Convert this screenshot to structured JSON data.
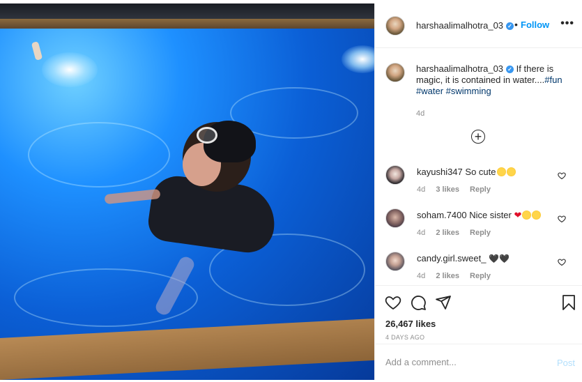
{
  "post": {
    "author": {
      "username": "harshaalimalhotra_03",
      "verified": true,
      "follow_label": "Follow",
      "separator": "•"
    },
    "more_icon": "more-options-icon",
    "caption": {
      "text": "If there is magic, it is contained in water....",
      "hashtags": [
        "#fun",
        "#water",
        "#swimming"
      ],
      "age": "4d"
    },
    "load_more_icon": "plus-circle-icon",
    "comments": [
      {
        "username": "kayushi347",
        "text": "So cute",
        "emojis": [
          "heart-eyes-emoji",
          "grinning-squint-emoji"
        ],
        "age": "4d",
        "likes": "3 likes",
        "reply_label": "Reply"
      },
      {
        "username": "soham.7400",
        "text": "Nice sister",
        "emojis": [
          "red-heart-emoji",
          "kiss-emoji",
          "kiss-emoji"
        ],
        "age": "4d",
        "likes": "2 likes",
        "reply_label": "Reply"
      },
      {
        "username": "candy.girl.sweet_",
        "text": "🖤🖤",
        "emojis": [],
        "age": "4d",
        "likes": "2 likes",
        "reply_label": "Reply"
      }
    ],
    "actions": {
      "like_icon": "heart-outline-icon",
      "comment_icon": "comment-bubble-icon",
      "share_icon": "paper-plane-icon",
      "save_icon": "bookmark-icon"
    },
    "likes_count": "26,467 likes",
    "date": "4 DAYS AGO",
    "add_comment": {
      "placeholder": "Add a comment...",
      "post_label": "Post"
    },
    "colors": {
      "link": "#0095f6",
      "hashtag": "#00376b",
      "muted": "#8e8e8e",
      "verified": "#3897f0"
    }
  }
}
